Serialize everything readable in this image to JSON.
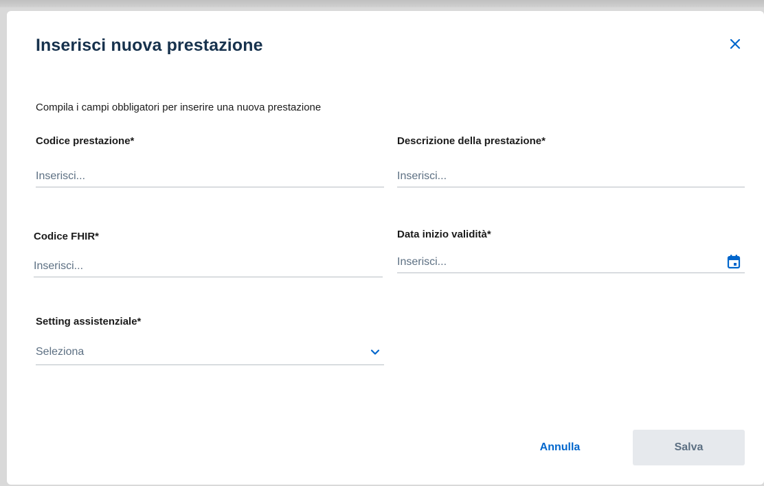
{
  "dialog": {
    "title": "Inserisci nuova prestazione",
    "intro": "Compila i campi obbligatori per inserire una nuova prestazione"
  },
  "fields": {
    "codice_prestazione": {
      "label": "Codice prestazione*",
      "value": "",
      "placeholder": "Inserisci..."
    },
    "descrizione": {
      "label": "Descrizione della prestazione*",
      "value": "",
      "placeholder": "Inserisci..."
    },
    "codice_fhir": {
      "label": "Codice FHIR*",
      "value": "",
      "placeholder": "Inserisci..."
    },
    "data_inizio": {
      "label": "Data inizio validità*",
      "value": "",
      "placeholder": "Inserisci..."
    },
    "setting": {
      "label": "Setting assistenziale*",
      "selected": "Seleziona"
    }
  },
  "actions": {
    "cancel_label": "Annulla",
    "save_label": "Salva"
  },
  "icons": {
    "close": "close-icon",
    "calendar": "calendar-icon",
    "chevron": "chevron-down-icon"
  },
  "colors": {
    "title": "#17324d",
    "accent": "#0066cc",
    "placeholder": "#5c6f82",
    "disabled_bg": "#e6e9ed"
  }
}
